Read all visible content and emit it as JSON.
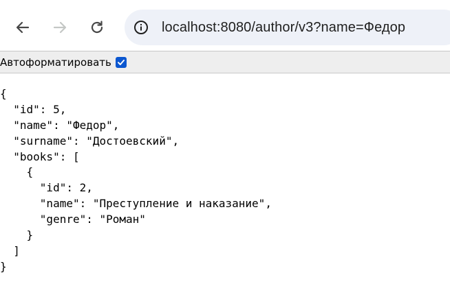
{
  "address_bar": {
    "url": "localhost:8080/author/v3?name=Федор"
  },
  "prettyprint": {
    "label": "Автоформатировать",
    "checked": true
  },
  "json_lines": [
    "{",
    "  \"id\": 5,",
    "  \"name\": \"Федор\",",
    "  \"surname\": \"Достоевский\",",
    "  \"books\": [",
    "    {",
    "      \"id\": 2,",
    "      \"name\": \"Преступление и наказание\",",
    "      \"genre\": \"Роман\"",
    "    }",
    "  ]",
    "}"
  ],
  "colors": {
    "omnibox_bg": "#eef1f8",
    "checkbox_accent": "#0b57d0",
    "icon_active": "#474747",
    "icon_disabled": "#c4c7c5"
  },
  "icons": {
    "back": "arrow-left-icon",
    "forward": "arrow-right-icon",
    "reload": "reload-icon",
    "site_info": "info-circle-icon",
    "checkbox": "checkmark-icon"
  }
}
